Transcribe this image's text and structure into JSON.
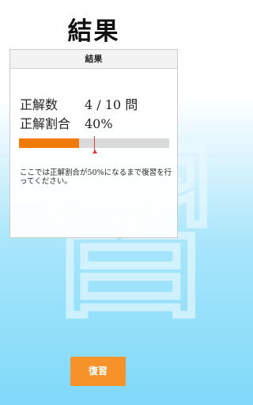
{
  "page": {
    "title": "結果",
    "background_glyph": "習"
  },
  "card": {
    "header": "結果",
    "correct_label": "正解数",
    "correct_value": "4 / 10 問",
    "ratio_label": "正解割合",
    "ratio_value": "40%",
    "progress_fraction": 0.4,
    "threshold_fraction": 0.5,
    "note": "ここでは正解割合が50%になるまで復習を行ってください。"
  },
  "actions": {
    "review_label": "復習"
  },
  "colors": {
    "progress_fill": "#f07a0c",
    "progress_track": "#dadada",
    "threshold_marker": "#e33b3b",
    "button": "#f6922a",
    "background_bottom": "#7fd9f9"
  }
}
